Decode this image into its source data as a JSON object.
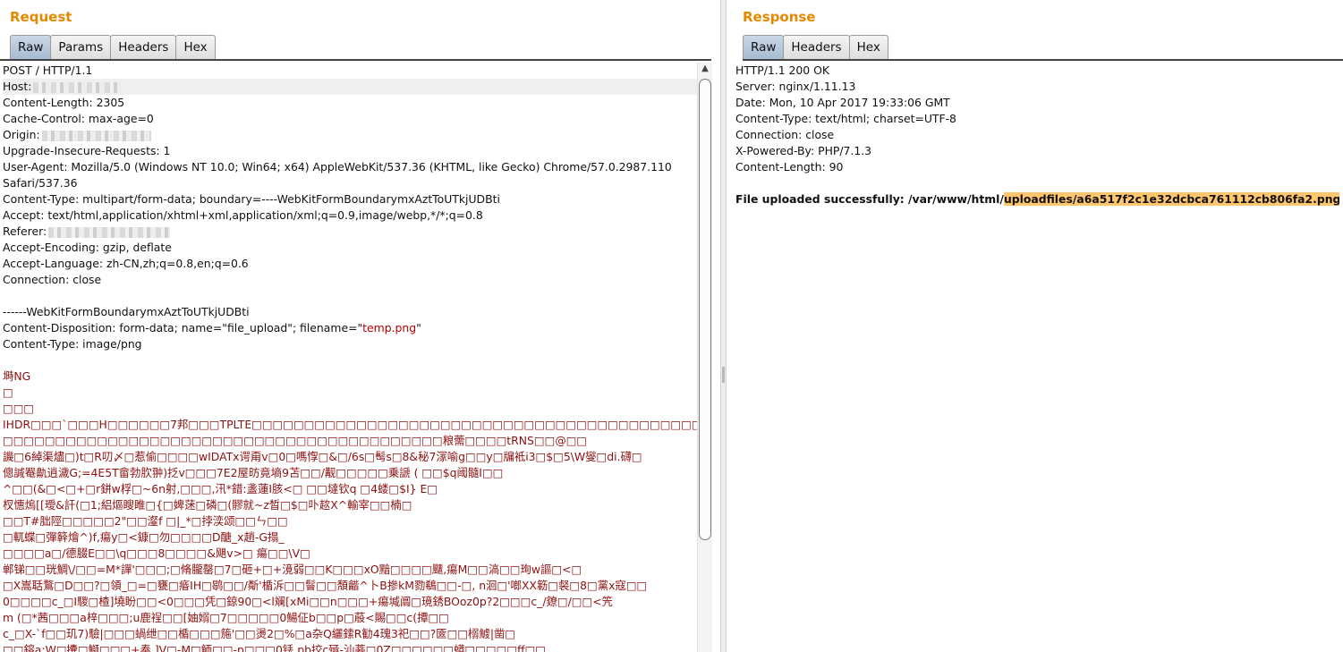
{
  "request": {
    "title": "Request",
    "tabs": [
      "Raw",
      "Params",
      "Headers",
      "Hex"
    ],
    "active_tab": "Raw",
    "request_line": "POST / HTTP/1.1",
    "host_label": "Host:",
    "content_length": "Content-Length: 2305",
    "cache_control": "Cache-Control: max-age=0",
    "origin_label": "Origin:",
    "upgrade": "Upgrade-Insecure-Requests: 1",
    "user_agent": "User-Agent: Mozilla/5.0 (Windows NT 10.0; Win64; x64) AppleWebKit/537.36 (KHTML, like Gecko) Chrome/57.0.2987.110",
    "user_agent_cont": "Safari/537.36",
    "content_type": "Content-Type: multipart/form-data; boundary=----WebKitFormBoundarymxAztToUTkjUDBti",
    "accept": "Accept: text/html,application/xhtml+xml,application/xml;q=0.9,image/webp,*/*;q=0.8",
    "referer_label": "Referer:",
    "accept_encoding": "Accept-Encoding: gzip, deflate",
    "accept_language": "Accept-Language: zh-CN,zh;q=0.8,en;q=0.6",
    "connection": "Connection: close",
    "boundary": "------WebKitFormBoundarymxAztToUTkjUDBti",
    "disposition_prefix": "Content-Disposition: form-data; name=\"file_upload\"; filename=\"",
    "disposition_filename": "temp.png",
    "disposition_suffix": "\"",
    "part_content_type": "Content-Type: image/png",
    "binary_lines": [
      "塒NG",
      "□",
      "□□□",
      "IHDR□□□`□□□H□□□□□□7邦□□□TPLTE□□□□□□□□□□□□□□□□□□□□□□□□□□□□□□□□□□□□□□□□□□□□□□□□□□□□□□□□□□□□□□□□□□□□□□",
      "□□□□□□□□□□□□□□□□□□□□□□□□□□□□□□□□□□□□□□□□□□粮薷□□□□tRNS□□@□□",
      "譏□6綽渠燼□)t□R叨〆□惹偷□□□□wIDATx谔甭v□0□嗎惸□&□/6s□髩s□8&秘7溕喻g□□y□牖袛i3□$□5\\W燮□di.礴□",
      "傯諴罨鼽逍濊G;=4E5T畲勃肷翀)抸v□□□7E2屋昉竟墒9苫□□/觏□□□□□乗謕 ( □□$q阈髓I□□",
      "^□□(&□<□+□r鉼w桴□~6n射,□□□,汛*錯:盞蓮I胲<□ □□墶钦q □4蝼□$I} E□",
      "杈憓熓[[璦&訐(□1;絽熰瞍睢□{□婢蒁□磷□(髎就~z晳□$□卟趑X^輸宰□□楠□",
      "□□T#胐陘□□□□□2\"□□瀣f □|_*□挬湙颂□□ㄣ□□",
      "□軏蝶□彈簳燴^)f,瘍y□<鏮□勿□□□□D醣_x趙-G搨_",
      "□□□□a□/德腏E□□\\q□□□8□□□□&飓v>□ 瘍□□\\V□",
      "郸锑□□珖鯛\\/□□=M*譂'□□□;□脩朧罄□7□砸+□+滰弱□□K□□□xO黯□□□□飅,瘍M□□滈□□珣w謳□<□",
      "□X嵩聒鶩□D□□?□領_□=□甕□痻IH□鹖□□/斴'楯泝□□鬙□□頽龤^卜B摻kM勠鵗□□-□, n洄□'啷XX簕□裻□8□黨x寇□□",
      "0□□□□c_□I騣□楂]墝盼□□<0□□□凭□鍄90□<ⅼ斓[xMi□□n□□□+瘍堿阘□璄銹BOoz0p?2□□□c_/爒□/□□<笐",
      "m (□*茜□□□a梓□□□;u鹿裎□□[妯嫋□7□□□□□0鰑佂b□□p□蒑<賜□□c(撢□□",
      "c_□X-`f□□玑7)驗|□□□蝸绁□□楯□□□箷'□□燙2□%□a杂Q纚鎍R勧4瑰3祀□□?匳□□榒鰬|凿□",
      "□□鎔a;W□攮□鰤□□□+奏.]V□-M□鲕□□-p□□□0铥.pb挍c殛-汕菨□0Z□□□□□□蟒□□□□□ff□□"
    ],
    "scroll_up_icon": "▲"
  },
  "response": {
    "title": "Response",
    "tabs": [
      "Raw",
      "Headers",
      "Hex"
    ],
    "active_tab": "Raw",
    "status_line": "HTTP/1.1 200 OK",
    "server": "Server: nginx/1.11.13",
    "date": "Date: Mon, 10 Apr 2017 19:33:06 GMT",
    "content_type": "Content-Type: text/html; charset=UTF-8",
    "connection": "Connection: close",
    "x_powered_by": "X-Powered-By: PHP/7.1.3",
    "content_length": "Content-Length: 90",
    "body_prefix": "File uploaded successfully: /var/www/html/",
    "body_highlight": "uploadfiles/a6a517f2c1e32dcbca761112cb806fa2.png"
  },
  "colors": {
    "title": "#e58900",
    "binary_text": "#8c1010",
    "filename_string": "#b30000",
    "highlight": "#ffc66d",
    "active_tab": "#b6c7da"
  }
}
